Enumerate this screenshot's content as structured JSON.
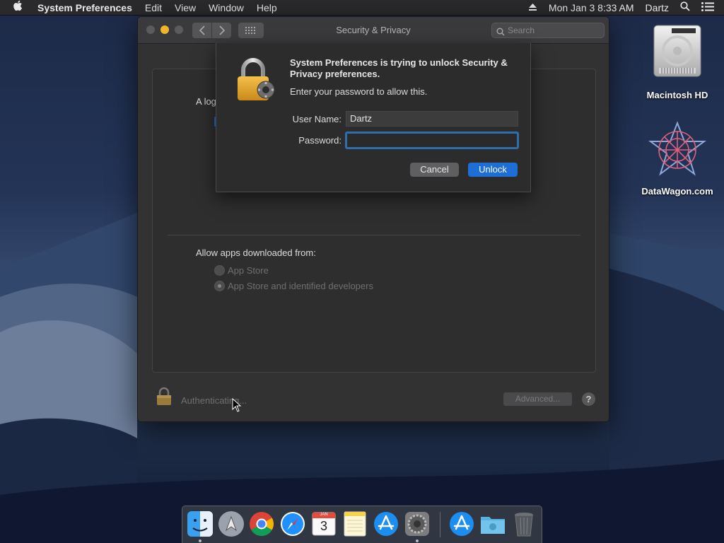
{
  "menubar": {
    "app_name": "System Preferences",
    "menus": [
      "Edit",
      "View",
      "Window",
      "Help"
    ],
    "datetime": "Mon Jan 3  8:33 AM",
    "user": "Dartz"
  },
  "desktop_icons": [
    {
      "label": "Macintosh HD",
      "icon": "hard-drive-icon"
    },
    {
      "label": "DataWagon.com",
      "icon": "datawagon-logo-icon"
    }
  ],
  "window": {
    "title": "Security & Privacy",
    "search_placeholder": "Search",
    "login_label": "A log",
    "allow_label": "Allow apps downloaded from:",
    "radio_options": [
      {
        "label": "App Store",
        "selected": false
      },
      {
        "label": "App Store and identified developers",
        "selected": true
      }
    ],
    "auth_status": "Authenticating...",
    "advanced_label": "Advanced...",
    "help_label": "?"
  },
  "auth_sheet": {
    "title": "System Preferences is trying to unlock Security & Privacy preferences.",
    "subtitle": "Enter your password to allow this.",
    "username_label": "User Name:",
    "username_value": "Dartz",
    "password_label": "Password:",
    "password_value": "",
    "cancel_label": "Cancel",
    "unlock_label": "Unlock"
  },
  "dock": {
    "items": [
      {
        "name": "finder",
        "running": true
      },
      {
        "name": "launchpad",
        "running": false
      },
      {
        "name": "chrome",
        "running": false
      },
      {
        "name": "safari",
        "running": false
      },
      {
        "name": "calendar",
        "running": false,
        "day": "3",
        "month": "JAN"
      },
      {
        "name": "notes",
        "running": false
      },
      {
        "name": "app-store",
        "running": false
      },
      {
        "name": "system-preferences",
        "running": true
      },
      {
        "name": "app-store-downloads",
        "running": false
      },
      {
        "name": "downloads-folder",
        "running": false
      },
      {
        "name": "trash",
        "running": false
      }
    ]
  },
  "colors": {
    "accent": "#1f6ed6",
    "focus_ring": "#2f6ea8",
    "window_bg": "#323232",
    "menubar_bg": "#2a2a2c",
    "minimize": "#f0b52b"
  }
}
